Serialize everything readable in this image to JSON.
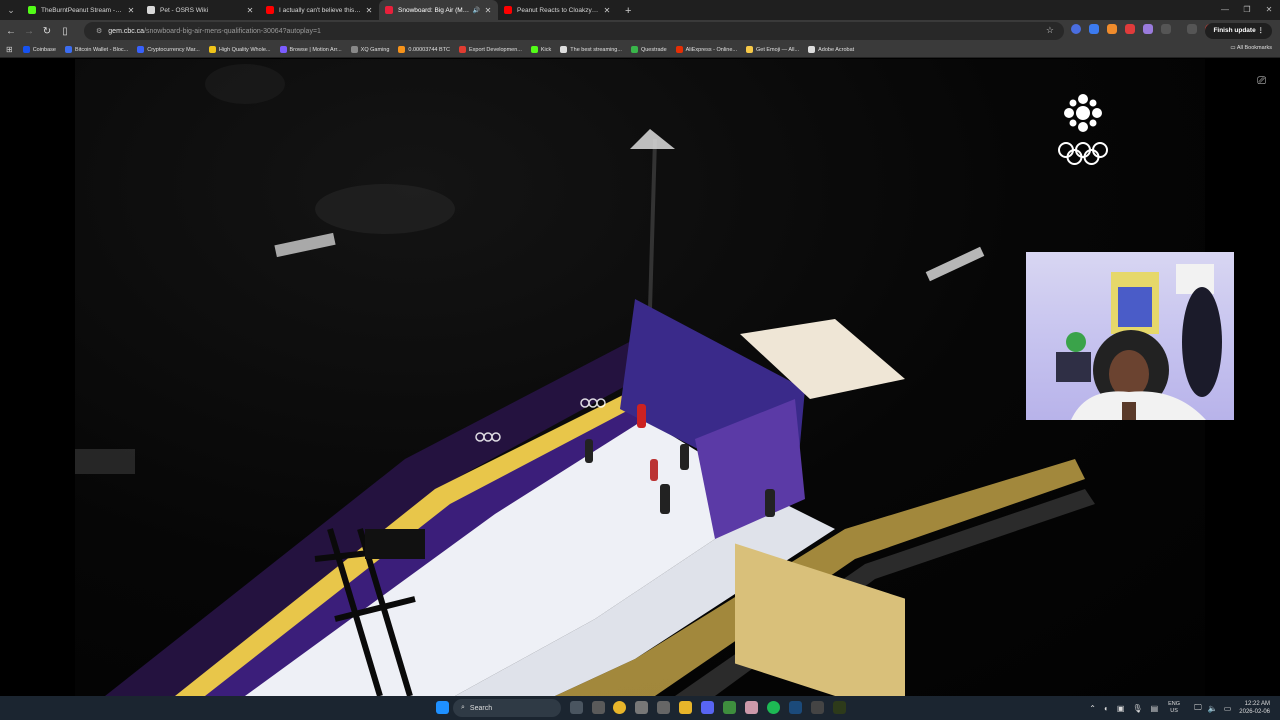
{
  "browser": {
    "tabs": [
      {
        "title": "TheBurntPeanut Stream - Watc",
        "favicon_color": "#53fc18",
        "active": false
      },
      {
        "title": "Pet - OSRS Wiki",
        "favicon_color": "#d9d9d9",
        "active": false
      },
      {
        "title": "I actually can't believe this... - Y",
        "favicon_color": "#ff0000",
        "active": false
      },
      {
        "title": "Snowboard: Big Air (Men's",
        "favicon_color": "#e8203b",
        "active": true
      },
      {
        "title": "Peanut Reacts to Cloakzy Slip U",
        "favicon_color": "#ff0000",
        "active": false
      }
    ],
    "tab_menu_icon": "chevron-down-icon",
    "new_tab_label": "+",
    "url_host": "gem.cbc.ca",
    "url_path": "/snowboard-big-air-mens-qualification-30064?autoplay=1",
    "finish_update_label": "Finish update",
    "bookmarks": [
      {
        "label": "Coinbase",
        "color": "#1652f0"
      },
      {
        "label": "Bitcoin Wallet - Bloc...",
        "color": "#3c6df0"
      },
      {
        "label": "Cryptocurrency Mar...",
        "color": "#3861fb"
      },
      {
        "label": "High Quality Whole...",
        "color": "#f0c419"
      },
      {
        "label": "Browse | Motion Arr...",
        "color": "#7b5cff"
      },
      {
        "label": "XQ Gaming",
        "color": "#888888"
      },
      {
        "label": "0.00003744 BTC",
        "color": "#f7931a"
      },
      {
        "label": "Export Developmen...",
        "color": "#e03c31"
      },
      {
        "label": "Kick",
        "color": "#53fc18"
      },
      {
        "label": "The best streaming...",
        "color": "#dddddd"
      },
      {
        "label": "Questrade",
        "color": "#39b54a"
      },
      {
        "label": "AliExpress - Online...",
        "color": "#e62e04"
      },
      {
        "label": "Get Emoji — All...",
        "color": "#f7c948"
      },
      {
        "label": "Adobe Acrobat",
        "color": "#dddddd"
      }
    ],
    "all_bookmarks_label": "All Bookmarks"
  },
  "taskbar": {
    "search_label": "Search",
    "lang_top": "ENG",
    "lang_bottom": "US",
    "time": "12:22 AM",
    "date": "2026-02-06"
  },
  "colors": {
    "tab_strip": "#1f1f1f",
    "toolbar": "#3a3a3a",
    "taskbar": "#1b2530",
    "accent_olympic_purple": "#4b2a8a"
  }
}
